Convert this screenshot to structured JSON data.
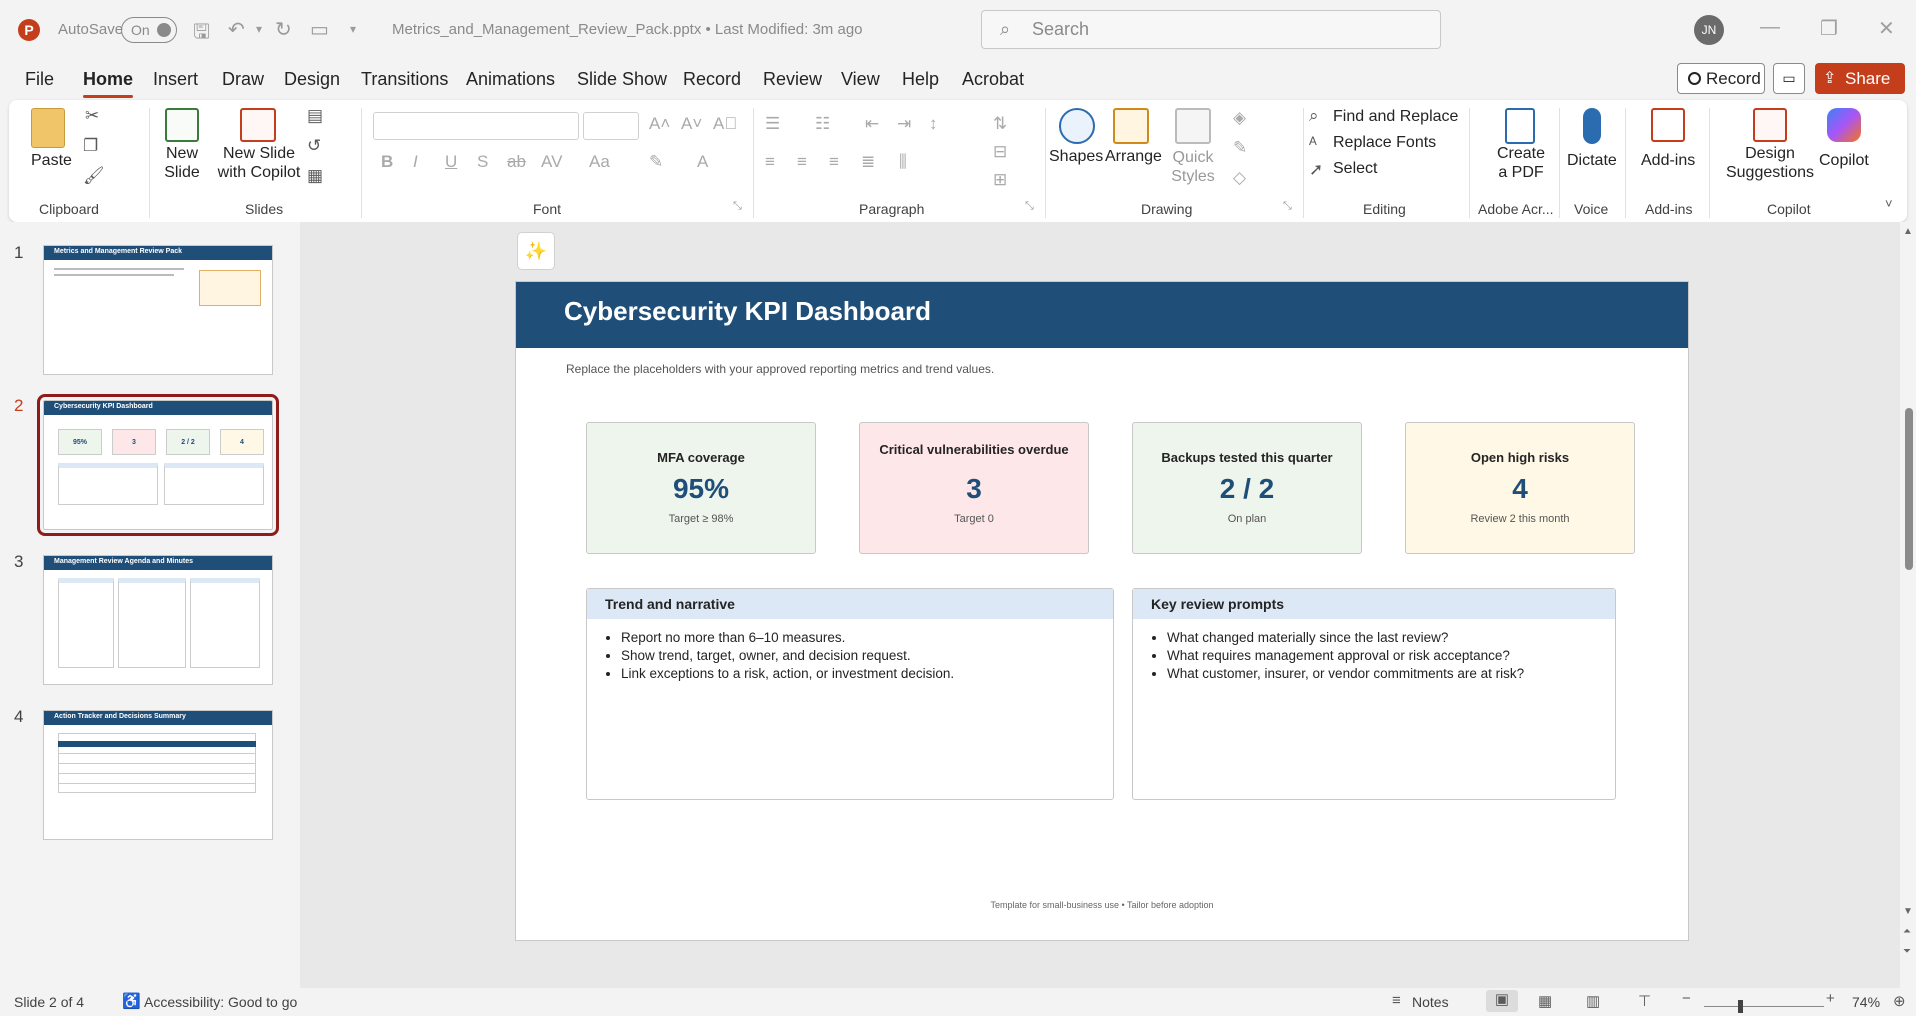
{
  "titlebar": {
    "app_letter": "P",
    "autosave_label": "AutoSave",
    "autosave_state": "On",
    "document_title": "Metrics_and_Management_Review_Pack.pptx • Last Modified: 3m ago",
    "search_placeholder": "Search",
    "user_initials": "JN"
  },
  "menu": {
    "items": [
      "File",
      "Home",
      "Insert",
      "Draw",
      "Design",
      "Transitions",
      "Animations",
      "Slide Show",
      "Record",
      "Review",
      "View",
      "Help",
      "Acrobat"
    ],
    "active": "Home",
    "record_label": "Record",
    "share_label": "Share"
  },
  "ribbon": {
    "clipboard": {
      "paste": "Paste",
      "label": "Clipboard"
    },
    "slides": {
      "new_slide": "New Slide",
      "new_slide_copilot": "New Slide with Copilot",
      "label": "Slides"
    },
    "font": {
      "label": "Font"
    },
    "paragraph": {
      "label": "Paragraph"
    },
    "drawing": {
      "shapes": "Shapes",
      "arrange": "Arrange",
      "quick_styles": "Quick Styles",
      "label": "Drawing"
    },
    "editing": {
      "find_replace": "Find and Replace",
      "replace_fonts": "Replace Fonts",
      "select": "Select",
      "label": "Editing"
    },
    "adobe": {
      "create_pdf": "Create a PDF",
      "label": "Adobe Acr..."
    },
    "voice": {
      "dictate": "Dictate",
      "label": "Voice"
    },
    "addins": {
      "addins": "Add-ins",
      "label": "Add-ins"
    },
    "copilot": {
      "design_suggestions": "Design Suggestions",
      "copilot": "Copilot",
      "label": "Copilot"
    }
  },
  "thumbnails": [
    {
      "num": "1",
      "title": "Metrics and Management Review Pack"
    },
    {
      "num": "2",
      "title": "Cybersecurity KPI Dashboard",
      "k1": "95%",
      "k2": "3",
      "k3": "2 / 2",
      "k4": "4"
    },
    {
      "num": "3",
      "title": "Management Review Agenda and Minutes"
    },
    {
      "num": "4",
      "title": "Action Tracker and Decisions Summary"
    }
  ],
  "slide": {
    "title": "Cybersecurity KPI Dashboard",
    "subtitle": "Replace the placeholders with your approved reporting metrics and trend values.",
    "kpis": [
      {
        "label": "MFA coverage",
        "value": "95%",
        "note": "Target ≥ 98%",
        "bg": "#eef5ec"
      },
      {
        "label": "Critical vulnerabilities overdue",
        "value": "3",
        "note": "Target 0",
        "bg": "#fde7e9"
      },
      {
        "label": "Backups tested this quarter",
        "value": "2 / 2",
        "note": "On plan",
        "bg": "#eef5ec"
      },
      {
        "label": "Open high risks",
        "value": "4",
        "note": "Review 2 this month",
        "bg": "#fff8e6"
      }
    ],
    "trend": {
      "heading": "Trend and narrative",
      "bullets": [
        "Report no more than 6–10 measures.",
        "Show trend, target, owner, and decision request.",
        "Link exceptions to a risk, action, or investment decision."
      ]
    },
    "prompts": {
      "heading": "Key review prompts",
      "bullets": [
        "What changed materially since the last review?",
        "What requires management approval or risk acceptance?",
        "What customer, insurer, or vendor commitments are at risk?"
      ]
    },
    "footer": "Template for small-business use • Tailor before adoption"
  },
  "status": {
    "slide_info": "Slide 2 of 4",
    "accessibility": "Accessibility: Good to go",
    "notes": "Notes",
    "zoom": "74%"
  },
  "colors": {
    "accent": "#c43e1c",
    "header": "#1f4e79",
    "selected_thumb": "#8f1b1b"
  }
}
